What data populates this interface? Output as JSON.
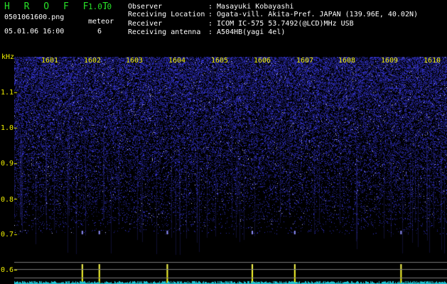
{
  "app": {
    "name": "H R O F F T",
    "version": "1.0.0"
  },
  "file": {
    "name": "0501061600.png",
    "datetime": "05.01.06 16:00"
  },
  "meteor": {
    "label": "meteor",
    "count": "6"
  },
  "info": [
    {
      "key": "Observer",
      "value": ": Masayuki Kobayashi"
    },
    {
      "key": "Receiving Location",
      "value": ": Ogata-vill. Akita-Pref. JAPAN (139.96E, 40.02N)"
    },
    {
      "key": "Receiver",
      "value": ": ICOM IC-575 53.7492(@LCD)MHz USB"
    },
    {
      "key": "Receiving antenna",
      "value": ": A504HB(yagi 4el)"
    }
  ],
  "axes": {
    "y_unit": "kHz",
    "y_ticks": [
      "1.1",
      "1.0",
      "0.9",
      "0.8",
      "0.7",
      "0.6"
    ],
    "x_ticks": [
      "1601",
      "1602",
      "1603",
      "1604",
      "1605",
      "1606",
      "1607",
      "1608",
      "1609",
      "1610"
    ]
  },
  "colors": {
    "label": "#28e028",
    "value": "#ffffff",
    "axis": "#f0f000",
    "noise": "#3a3aff",
    "background": "#000000"
  },
  "meteor_echoes_minute": [
    1601.8,
    1602.2,
    1603.8,
    1605.8,
    1606.8,
    1609.3
  ]
}
